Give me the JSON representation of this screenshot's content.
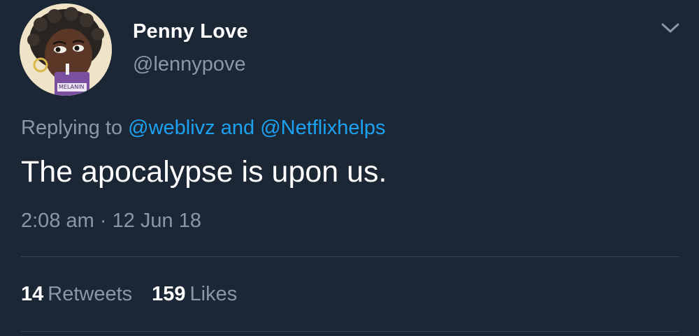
{
  "user": {
    "display_name": "Penny Love",
    "handle": "@lennypove",
    "avatar_text": "MELANIN",
    "menu_icon": "chevron-down-icon"
  },
  "reply": {
    "prefix": "Replying to ",
    "mention_1": "@weblivz",
    "conjunction": " and ",
    "mention_2": "@Netflixhelps"
  },
  "tweet": {
    "text": "The apocalypse is upon us.",
    "time": "2:08 am",
    "separator": " · ",
    "date": "12 Jun 18"
  },
  "stats": {
    "retweets_count": "14",
    "retweets_label": "Retweets",
    "likes_count": "159",
    "likes_label": "Likes"
  },
  "colors": {
    "background": "#1c2735",
    "muted_text": "#8899a6",
    "link": "#1da1f2",
    "divider": "#38444d"
  }
}
